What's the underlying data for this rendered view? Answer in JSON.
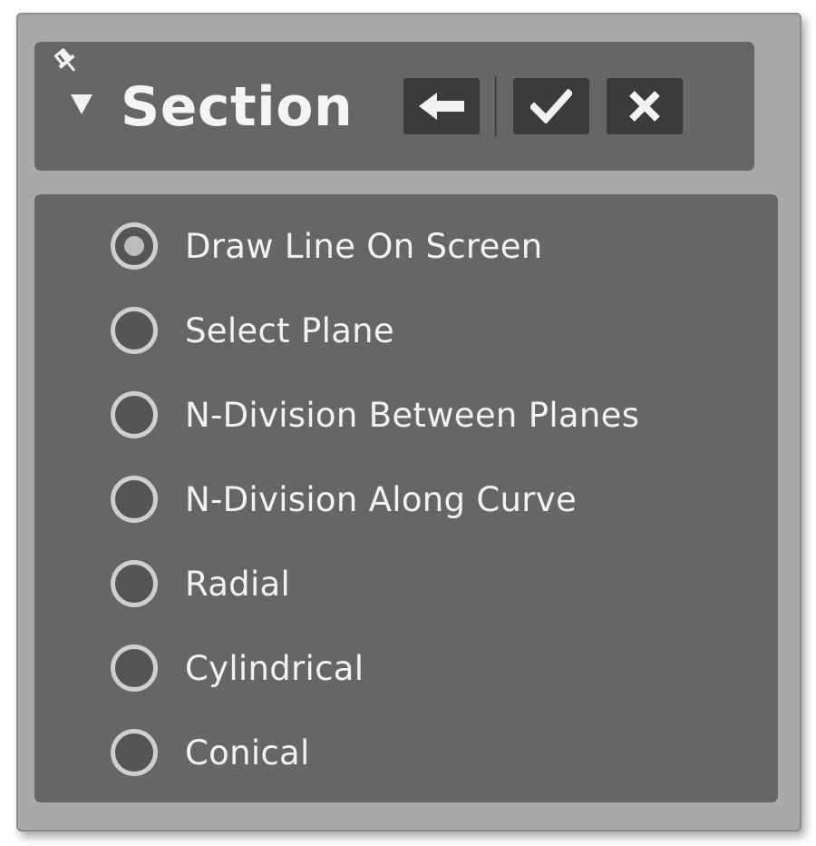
{
  "dialog": {
    "title": "Section",
    "buttons": {
      "back": "back-arrow-icon",
      "ok": "check-icon",
      "cancel": "close-icon"
    }
  },
  "options": [
    {
      "label": "Draw Line On Screen",
      "selected": true
    },
    {
      "label": "Select Plane",
      "selected": false
    },
    {
      "label": "N-Division Between Planes",
      "selected": false
    },
    {
      "label": "N-Division Along Curve",
      "selected": false
    },
    {
      "label": "Radial",
      "selected": false
    },
    {
      "label": "Cylindrical",
      "selected": false
    },
    {
      "label": "Conical",
      "selected": false
    }
  ]
}
